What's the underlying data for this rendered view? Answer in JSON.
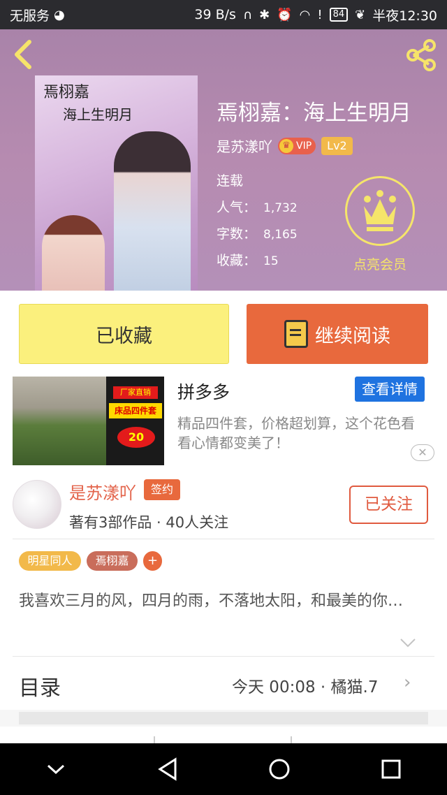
{
  "status_bar": {
    "carrier": "无服务",
    "net_speed": "39 B/s",
    "battery": "84",
    "time": "半夜12:30"
  },
  "book": {
    "title": "焉栩嘉：海上生明月",
    "cover_title_line1": "焉栩嘉",
    "cover_title_line2": "海上生明月",
    "author": "是苏漾吖",
    "vip_label": "VIP",
    "level_label": "Lv2",
    "status": "连载",
    "popularity_label": "人气：",
    "popularity_value": "1,732",
    "word_count_label": "字数：",
    "word_count_value": "8,165",
    "favorites_label": "收藏：",
    "favorites_value": "15",
    "vip_member_label": "点亮会员"
  },
  "actions": {
    "collected_label": "已收藏",
    "continue_label": "继续阅读"
  },
  "ad": {
    "title": "拼多多",
    "detail_button": "查看详情",
    "description": "精品四件套，价格超划算，这个花色看看心情都变美了！",
    "img_tag1": "厂家直销",
    "img_tag2": "床品四件套",
    "img_tag3": "20"
  },
  "author_card": {
    "name": "是苏漾吖",
    "badge": "签约",
    "meta": "著有3部作品 · 40人关注",
    "follow_label": "已关注"
  },
  "tags": [
    "明星同人",
    "焉栩嘉",
    "+"
  ],
  "intro": "我喜欢三月的风，四月的雨，不落地太阳，和最美的你…",
  "catalog": {
    "title": "目录",
    "update": "今天 00:08 · 橘猫.7"
  },
  "colors": {
    "accent_orange": "#e8693d",
    "collect_yellow": "#fbf07d",
    "gold": "#f5e56a"
  }
}
